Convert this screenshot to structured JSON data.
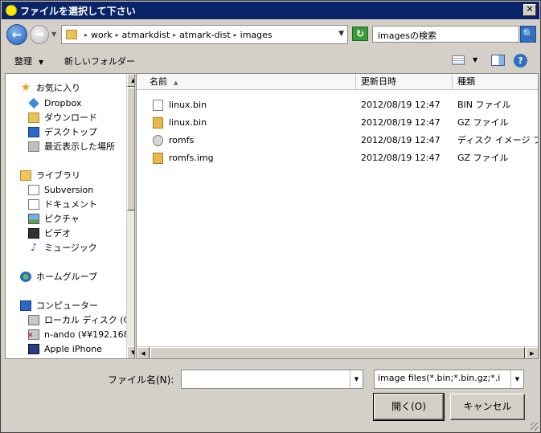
{
  "window": {
    "title": "ファイルを選択して下さい",
    "close_label": "✕"
  },
  "address": {
    "breadcrumbs": [
      "work",
      "atmarkdist",
      "atmark-dist",
      "images"
    ],
    "search_placeholder": "imagesの検索"
  },
  "toolbar": {
    "organize_label": "整理",
    "new_folder_label": "新しいフォルダー"
  },
  "nav": {
    "favorites": {
      "label": "お気に入り",
      "items": [
        "Dropbox",
        "ダウンロード",
        "デスクトップ",
        "最近表示した場所"
      ]
    },
    "libraries": {
      "label": "ライブラリ",
      "items": [
        "Subversion",
        "ドキュメント",
        "ピクチャ",
        "ビデオ",
        "ミュージック"
      ]
    },
    "homegroup_label": "ホームグループ",
    "computer": {
      "label": "コンピューター",
      "items": [
        "ローカル ディスク (C:)",
        "n-ando (¥¥192.168.",
        "Apple iPhone"
      ]
    }
  },
  "columns": {
    "name": "名前",
    "modified": "更新日時",
    "type": "種類"
  },
  "files": [
    {
      "name": "linux.bin",
      "modified": "2012/08/19 12:47",
      "type": "BIN ファイル",
      "icon": "bin-file-icon"
    },
    {
      "name": "linux.bin",
      "modified": "2012/08/19 12:47",
      "type": "GZ ファイル",
      "icon": "gz-file-icon"
    },
    {
      "name": "romfs",
      "modified": "2012/08/19 12:47",
      "type": "ディスク イメージ ファ...",
      "icon": "disk-image-icon"
    },
    {
      "name": "romfs.img",
      "modified": "2012/08/19 12:47",
      "type": "GZ ファイル",
      "icon": "gz-file-icon"
    }
  ],
  "footer": {
    "filename_label": "ファイル名(N):",
    "filename_value": "",
    "filetype_value": "image files(*.bin;*.bin.gz;*.i",
    "open_label": "開く(O)",
    "cancel_label": "キャンセル"
  }
}
